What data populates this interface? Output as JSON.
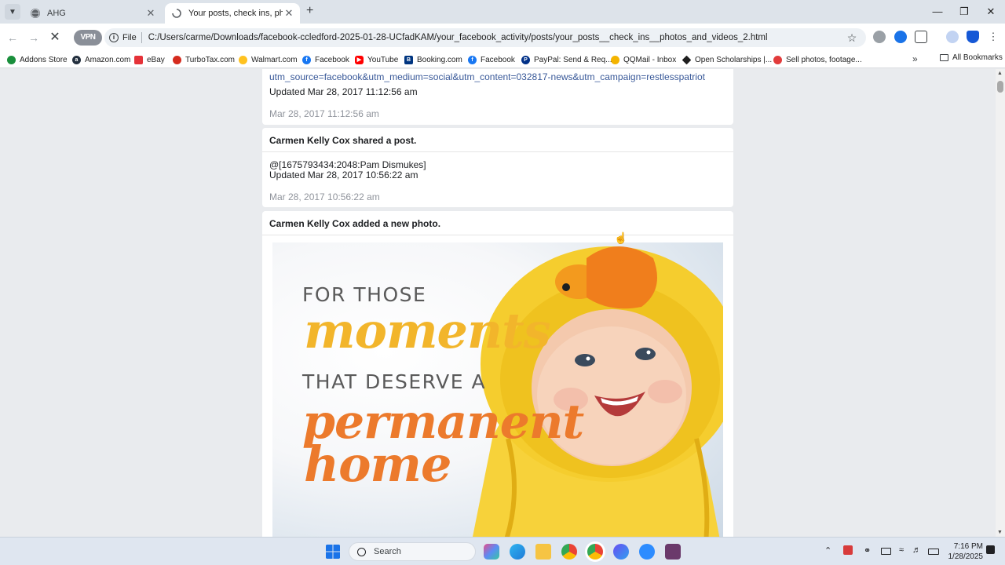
{
  "browser": {
    "tabs": [
      {
        "title": "AHG",
        "active": false
      },
      {
        "title": "Your posts, check ins, photos ar",
        "active": true
      }
    ],
    "new_tab_label": "+",
    "vpn_label": "VPN",
    "omnibox": {
      "scheme_label": "File",
      "url": "C:/Users/carme/Downloads/facebook-ccledford-2025-01-28-UCfadKAM/your_facebook_activity/posts/your_posts__check_ins__photos_and_videos_2.html"
    },
    "bookmarks": [
      {
        "label": "Addons Store",
        "color": "#1a8f3c"
      },
      {
        "label": "Amazon.com",
        "color": "#232f3e"
      },
      {
        "label": "eBay",
        "color": "#e53238"
      },
      {
        "label": "TurboTax.com",
        "color": "#d52b1e"
      },
      {
        "label": "Walmart.com",
        "color": "#ffc220"
      },
      {
        "label": "Facebook",
        "color": "#1877f2"
      },
      {
        "label": "YouTube",
        "color": "#ff0000"
      },
      {
        "label": "Booking.com",
        "color": "#003580"
      },
      {
        "label": "Facebook",
        "color": "#1877f2"
      },
      {
        "label": "PayPal: Send & Req...",
        "color": "#003087"
      },
      {
        "label": "QQMail - Inbox",
        "color": "#f4b400"
      },
      {
        "label": "Open Scholarships |...",
        "color": "#1f1f1f"
      },
      {
        "label": "Sell photos, footage...",
        "color": "#e23b3b"
      }
    ],
    "all_bookmarks_label": "All Bookmarks"
  },
  "page": {
    "post1": {
      "link_text": "utm_source=facebook&utm_medium=social&utm_content=032817-news&utm_campaign=restlesspatriot",
      "updated": "Updated Mar 28, 2017 11:12:56 am",
      "timestamp": "Mar 28, 2017 11:12:56 am"
    },
    "post2": {
      "header": "Carmen Kelly Cox shared a post.",
      "mention": "@[1675793434:2048:Pam Dismukes]",
      "updated": "Updated Mar 28, 2017 10:56:22 am",
      "timestamp": "Mar 28, 2017 10:56:22 am"
    },
    "post3": {
      "header": "Carmen Kelly Cox added a new photo.",
      "photo_text": {
        "line1": "FOR THOSE",
        "line2": "moments",
        "line3": "THAT DESERVE A",
        "line4": "permanent",
        "line5": "home"
      }
    }
  },
  "taskbar": {
    "search_placeholder": "Search",
    "time": "7:16 PM",
    "date": "1/28/2025"
  }
}
